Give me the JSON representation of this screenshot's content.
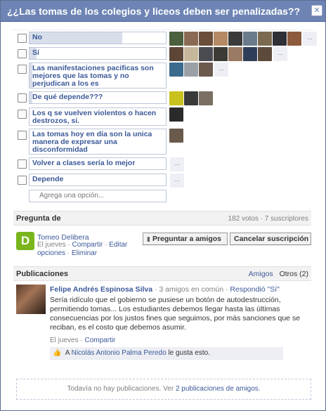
{
  "dialog": {
    "title": "¿¿Las tomas de los colegios y liceos deben ser penalizadas??",
    "close_glyph": "✕"
  },
  "options": [
    {
      "label": "No",
      "fill_fraction": 0.68,
      "avatar_colors": [
        "#4a5f3d",
        "#8a6a52",
        "#6b4e3a",
        "#b48a64",
        "#3a3a3a",
        "#6a7b8c",
        "#7c6a4f",
        "#2f2f36",
        "#8c5a3c"
      ],
      "more": "..."
    },
    {
      "label": "Sí",
      "fill_fraction": 0.05,
      "avatar_colors": [
        "#5d4636",
        "#c7b79a",
        "#4b4b52",
        "#3d3b36",
        "#9a7a62",
        "#2f3d58",
        "#5c4a3c"
      ],
      "more": "..."
    },
    {
      "label": "Las manifestaciones pacificas son mejores que las tomas y no perjudican a los es",
      "fill_fraction": 0.02,
      "avatar_colors": [
        "#3c6a8c",
        "#9aa0a6",
        "#6b5b4f"
      ],
      "more": "..."
    },
    {
      "label": "De qué depende???",
      "fill_fraction": 0.02,
      "avatar_colors": [
        "#c9c21e",
        "#3a3a3a",
        "#7a6f62"
      ],
      "more": ""
    },
    {
      "label": "Los q se vuelven violentos o hacen destrozos, si.",
      "fill_fraction": 0.0,
      "avatar_colors": [
        "#2a2a2a"
      ],
      "more": ""
    },
    {
      "label": "Las tomas hoy en día son la unica manera de expresar una disconformidad",
      "fill_fraction": 0.0,
      "avatar_colors": [
        "#6a5a4c"
      ],
      "more": ""
    },
    {
      "label": "Volver a clases sería lo mejor",
      "fill_fraction": 0.0,
      "avatar_colors": [],
      "more": "..."
    },
    {
      "label": "Depende",
      "fill_fraction": 0.0,
      "avatar_colors": [],
      "more": "..."
    }
  ],
  "add_option_placeholder": "Agrega una opción...",
  "asked_by": {
    "section_title": "Pregunta de",
    "stats": "182 votos · 7 suscriptores",
    "logo_letter": "D",
    "name": "Tomeo Delibera",
    "when": "El jueves",
    "share": "Compartir",
    "edit": "Editar opciones",
    "delete": "Eliminar"
  },
  "buttons": {
    "ask_friends": "Preguntar a amigos",
    "cancel_subscription": "Cancelar suscripción"
  },
  "publications": {
    "section_title": "Publicaciones",
    "tab_friends": "Amigos",
    "tab_others": "Otros (2)",
    "post": {
      "author": "Felipe Andrés Espinosa Silva",
      "friends_in_common": "3 amigos en común",
      "answered": "Respondió \"Sí\"",
      "text": "Sería ridículo que el gobierno se pusiese un botón de autodestrucción, permitiendo tomas... Los estudiantes debemos llegar hasta las últimas consecuencias por los justos fines que seguimos, por más sanciones que se reciban, es el costo que debemos asumir.",
      "when": "El jueves",
      "share": "Compartir",
      "likes_prefix": "A",
      "likes_person": "Nicolás Antonio Palma Peredo",
      "likes_suffix": "le gusta esto."
    },
    "empty_text": "Todavía no hay publicaciones. Ver",
    "empty_link": "2 publicaciones de amigos."
  }
}
